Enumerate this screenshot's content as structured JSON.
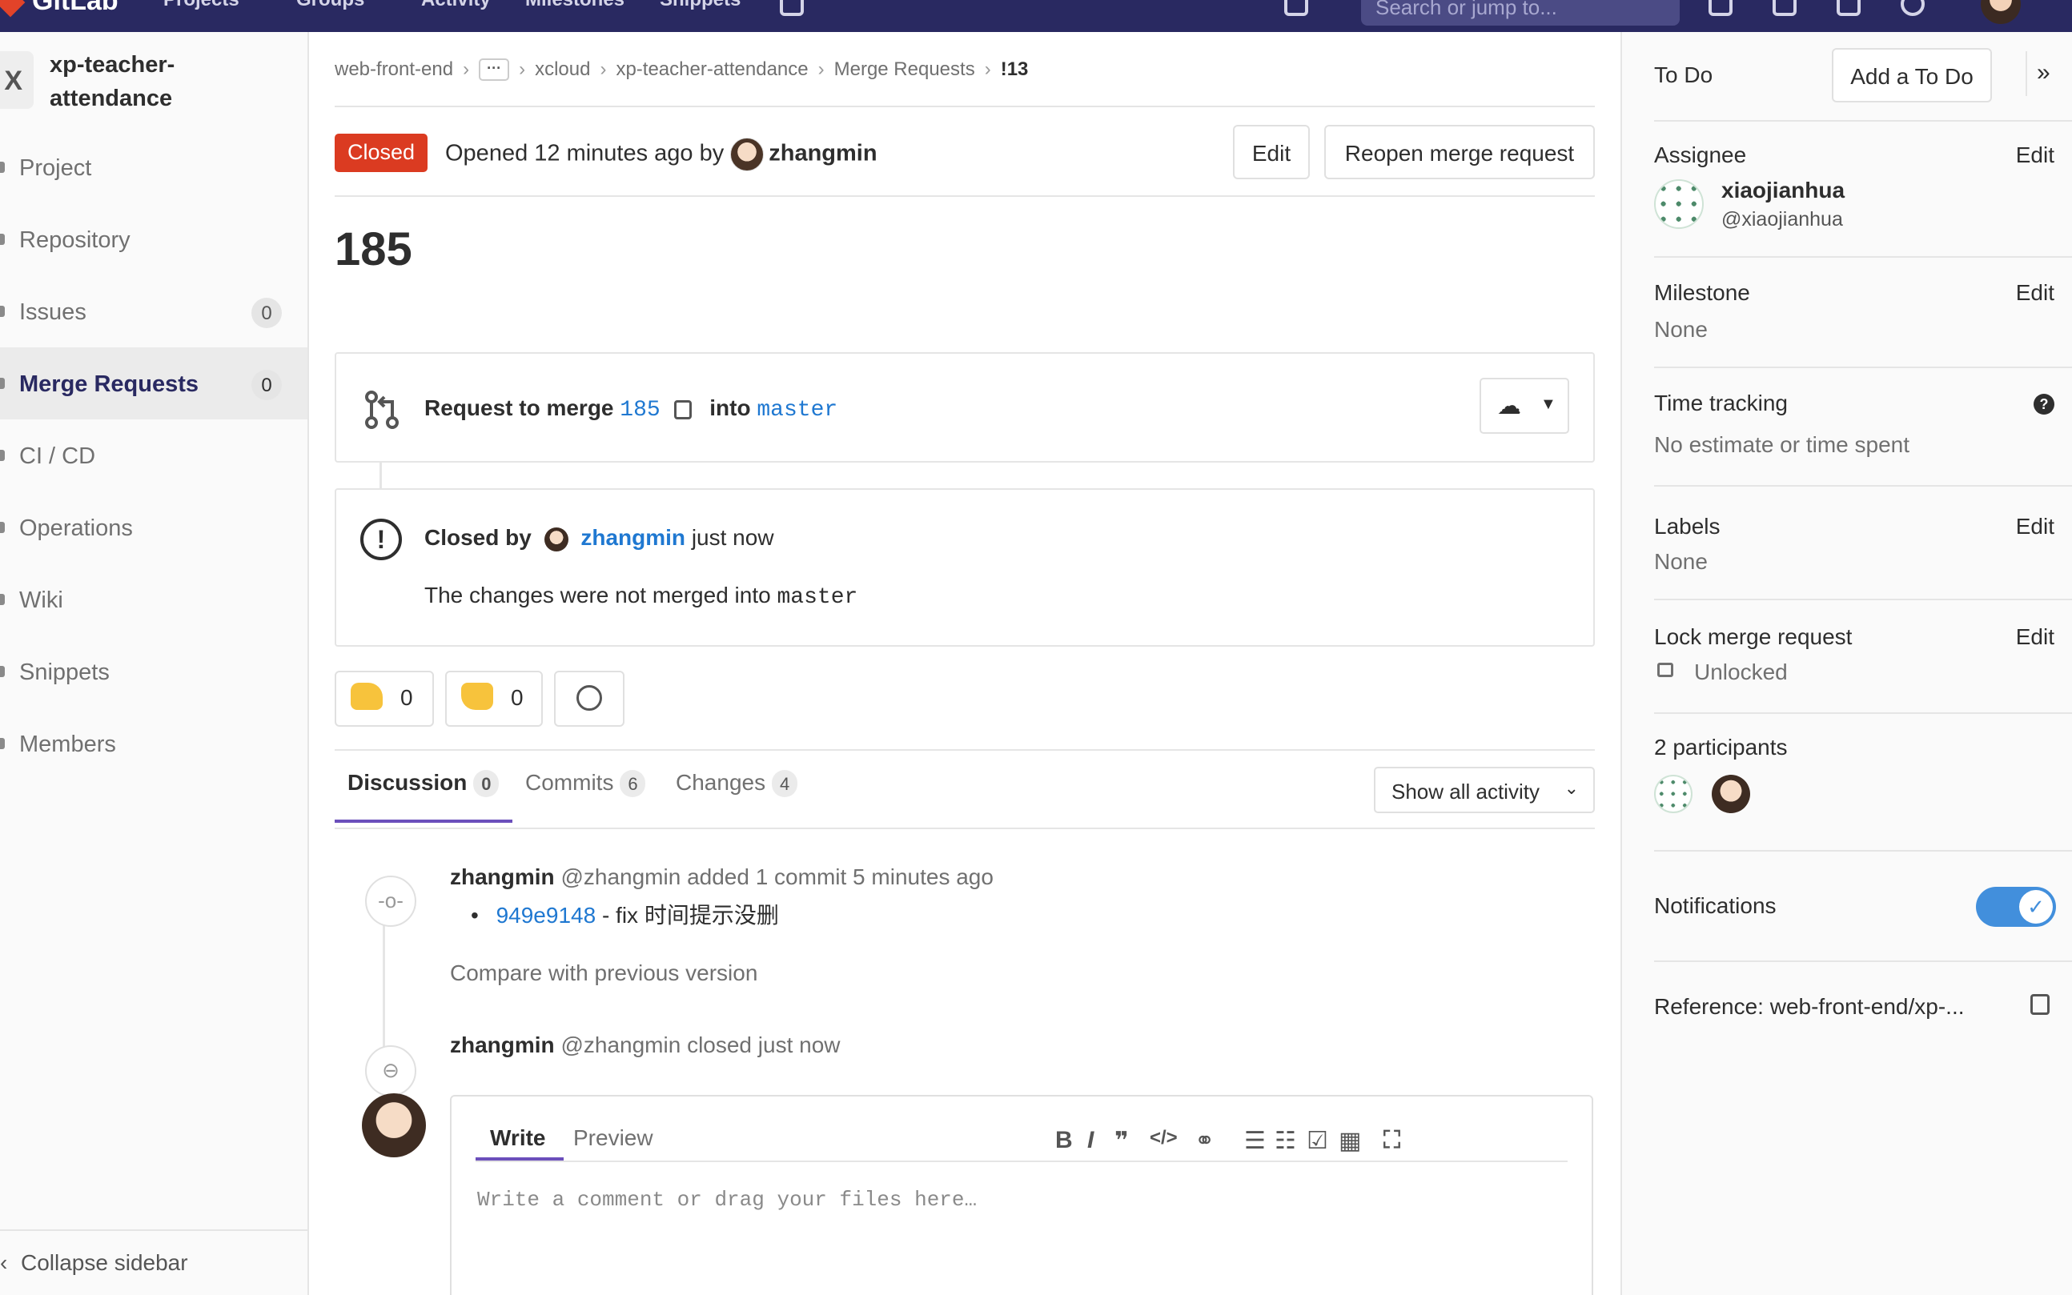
{
  "topbar": {
    "logo": "GitLab",
    "nav": [
      "Projects",
      "Groups",
      "Activity",
      "Milestones",
      "Snippets"
    ],
    "search_placeholder": "Search or jump to..."
  },
  "sidebar": {
    "project_letter": "X",
    "project_name": "xp-teacher-attendance",
    "items": [
      {
        "label": "Project"
      },
      {
        "label": "Repository"
      },
      {
        "label": "Issues",
        "count": "0"
      },
      {
        "label": "Merge Requests",
        "count": "0"
      },
      {
        "label": "CI / CD"
      },
      {
        "label": "Operations"
      },
      {
        "label": "Wiki"
      },
      {
        "label": "Snippets"
      },
      {
        "label": "Members"
      }
    ],
    "collapse_label": "Collapse sidebar"
  },
  "breadcrumb": {
    "items": [
      "web-front-end",
      "xcloud",
      "xp-teacher-attendance",
      "Merge Requests",
      "!13"
    ],
    "more": "···"
  },
  "header": {
    "status": "Closed",
    "opened_text": "Opened 12 minutes ago by",
    "author": "zhangmin",
    "edit_label": "Edit",
    "reopen_label": "Reopen merge request"
  },
  "title": "185",
  "merge_widget": {
    "prefix": "Request to merge",
    "source_branch": "185",
    "into": "into",
    "target_branch": "master"
  },
  "closed_widget": {
    "closed_by": "Closed by",
    "user": "zhangmin",
    "when": "just now",
    "message_prefix": "The changes were not merged into",
    "branch": "master"
  },
  "awards": {
    "thumbsup": "0",
    "thumbsdown": "0"
  },
  "tabs": [
    {
      "label": "Discussion",
      "count": "0"
    },
    {
      "label": "Commits",
      "count": "6"
    },
    {
      "label": "Changes",
      "count": "4"
    }
  ],
  "activity_filter": "Show all activity",
  "timeline": {
    "note1": {
      "author": "zhangmin",
      "text": "@zhangmin added 1 commit 5 minutes ago",
      "commit_sha": "949e9148",
      "commit_msg": "- fix 时间提示没删",
      "compare_link": "Compare with previous version"
    },
    "note2": {
      "author": "zhangmin",
      "text": "@zhangmin closed just now"
    }
  },
  "editor": {
    "write_tab": "Write",
    "preview_tab": "Preview",
    "placeholder": "Write a comment or drag your files here…"
  },
  "right_sidebar": {
    "todo_label": "To Do",
    "add_todo_label": "Add a To Do",
    "assignee_label": "Assignee",
    "edit_label": "Edit",
    "assignee_name": "xiaojianhua",
    "assignee_username": "@xiaojianhua",
    "milestone_label": "Milestone",
    "milestone_value": "None",
    "time_tracking_label": "Time tracking",
    "time_tracking_value": "No estimate or time spent",
    "labels_label": "Labels",
    "labels_value": "None",
    "lock_label": "Lock merge request",
    "lock_value": "Unlocked",
    "participants_label": "2 participants",
    "notifications_label": "Notifications",
    "notifications_on": true,
    "reference_label": "Reference: web-front-end/xp-..."
  },
  "colors": {
    "navbar": "#292961",
    "closed_badge": "#db3b21",
    "link": "#1f78d1",
    "active_tab": "#6b4fbb",
    "toggle": "#428fdc"
  }
}
